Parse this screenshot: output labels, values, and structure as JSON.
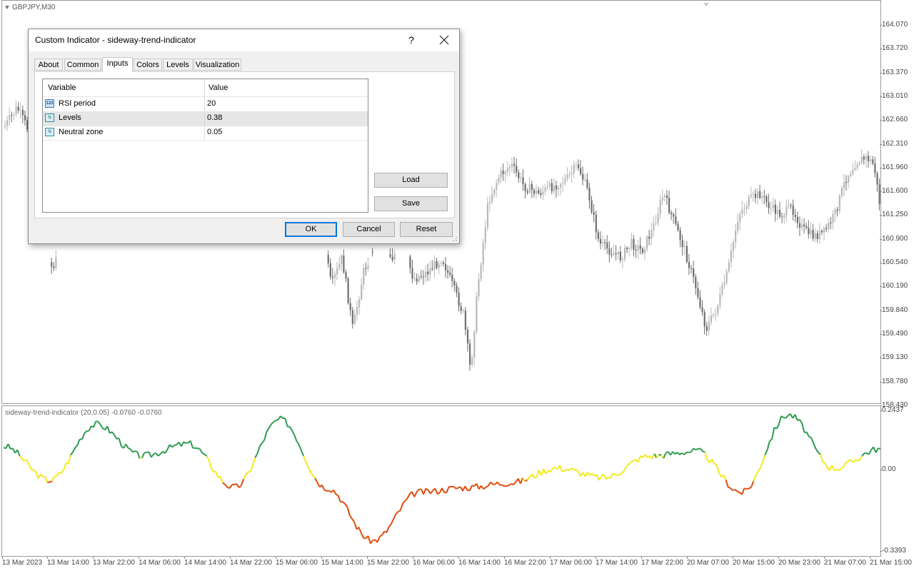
{
  "window": {
    "symbol": "GBPJPY,M30"
  },
  "price_axis": [
    "164.070",
    "163.720",
    "163.370",
    "163.010",
    "162.660",
    "162.310",
    "161.960",
    "161.600",
    "161.250",
    "160.900",
    "160.540",
    "160.190",
    "159.840",
    "159.490",
    "159.130",
    "158.780",
    "158.430"
  ],
  "indicator": {
    "label": "sideway-trend-indicator (20,0.05) -0.0760 -0.0760",
    "axis": [
      "0.2437",
      "0.00",
      "-0.3393"
    ],
    "colors": {
      "up": "#2e9b4f",
      "neutral": "#f2ea1a",
      "down": "#e04a0c"
    }
  },
  "time_axis": [
    "13 Mar 2023",
    "13 Mar 14:00",
    "13 Mar 22:00",
    "14 Mar 06:00",
    "14 Mar 14:00",
    "14 Mar 22:00",
    "15 Mar 06:00",
    "15 Mar 14:00",
    "15 Mar 22:00",
    "16 Mar 06:00",
    "16 Mar 14:00",
    "16 Mar 22:00",
    "17 Mar 06:00",
    "17 Mar 14:00",
    "17 Mar 22:00",
    "20 Mar 07:00",
    "20 Mar 15:00",
    "20 Mar 23:00",
    "21 Mar 07:00",
    "21 Mar 15:00"
  ],
  "chart_data": {
    "type": "line",
    "title": "sideway-trend-indicator (20,0.05) -0.0760 -0.0760",
    "x": [
      "13 Mar 2023",
      "13 Mar 14:00",
      "13 Mar 22:00",
      "14 Mar 06:00",
      "14 Mar 14:00",
      "14 Mar 22:00",
      "15 Mar 06:00",
      "15 Mar 14:00",
      "15 Mar 22:00",
      "16 Mar 06:00",
      "16 Mar 14:00",
      "16 Mar 22:00",
      "17 Mar 06:00",
      "17 Mar 14:00",
      "17 Mar 22:00",
      "20 Mar 07:00",
      "20 Mar 15:00",
      "20 Mar 23:00",
      "21 Mar 07:00",
      "21 Mar 15:00"
    ],
    "series": [
      {
        "values": [
          0.09,
          -0.05,
          0.18,
          0.05,
          0.1,
          -0.08,
          0.2,
          -0.08,
          -0.3,
          -0.1,
          -0.08,
          -0.06,
          0.0,
          -0.04,
          0.05,
          0.07,
          -0.1,
          0.22,
          0.0,
          0.08
        ]
      }
    ],
    "ylim": [
      -0.3393,
      0.2437
    ],
    "grid": false
  },
  "dialog": {
    "title": "Custom Indicator - sideway-trend-indicator",
    "help": "?",
    "tabs": [
      "About",
      "Common",
      "Inputs",
      "Colors",
      "Levels",
      "Visualization"
    ],
    "active_tab": "Inputs",
    "columns": {
      "variable": "Variable",
      "value": "Value"
    },
    "rows": [
      {
        "icon": "int-icon",
        "variable": "RSI period",
        "value": "20"
      },
      {
        "icon": "double-icon",
        "variable": "Levels",
        "value": "0.38"
      },
      {
        "icon": "double-icon",
        "variable": "Neutral zone",
        "value": "0.05"
      }
    ],
    "buttons": {
      "load": "Load",
      "save": "Save",
      "ok": "OK",
      "cancel": "Cancel",
      "reset": "Reset"
    }
  }
}
